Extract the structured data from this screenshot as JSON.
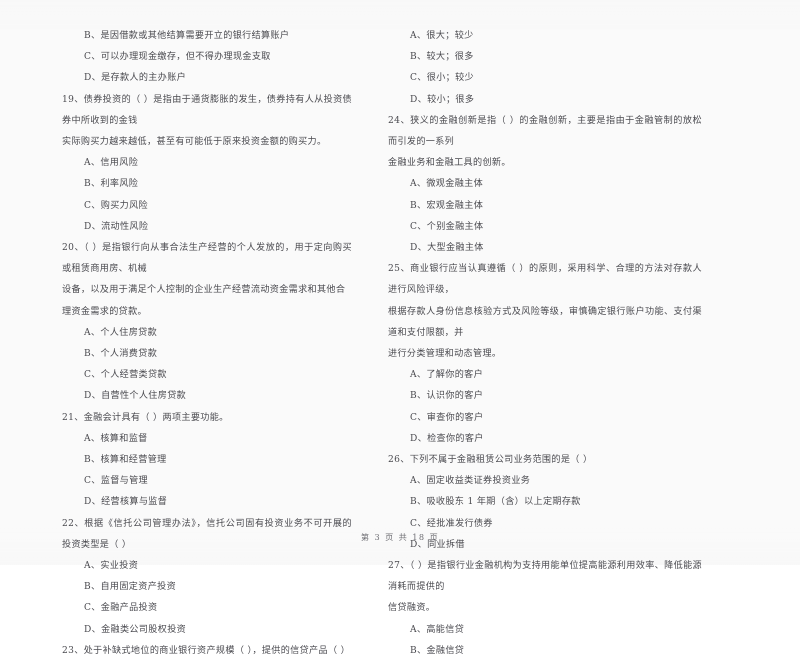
{
  "document": {
    "type": "exam-paper",
    "language": "zh-CN",
    "footer": "第 3 页 共 18 页"
  },
  "left_column": {
    "carryover_options": [
      "B、是因借款或其他结算需要开立的银行结算账户",
      "C、可以办理现金缴存，但不得办理现金支取",
      "D、是存款人的主办账户"
    ],
    "questions": [
      {
        "number": "19",
        "stem_line1": "19、债券投资的（      ）是指由于通货膨胀的发生，债券持有人从投资债券中所收到的金钱",
        "stem_line2": "实际购买力越来越低，甚至有可能低于原来投资金额的购买力。",
        "options": [
          "A、信用风险",
          "B、利率风险",
          "C、购买力风险",
          "D、流动性风险"
        ]
      },
      {
        "number": "20",
        "stem_line1": "20、（      ）是指银行向从事合法生产经营的个人发放的，用于定向购买或租赁商用房、机械",
        "stem_line2": "设备，以及用于满足个人控制的企业生产经营流动资金需求和其他合理资金需求的贷款。",
        "options": [
          "A、个人住房贷款",
          "B、个人消费贷款",
          "C、个人经营类贷款",
          "D、自营性个人住房贷款"
        ]
      },
      {
        "number": "21",
        "stem_line1": "21、金融会计具有（      ）两项主要功能。",
        "stem_line2": "",
        "options": [
          "A、核算和监督",
          "B、核算和经营管理",
          "C、监督与管理",
          "D、经营核算与监督"
        ]
      },
      {
        "number": "22",
        "stem_line1": "22、根据《信托公司管理办法》，信托公司固有投资业务不可开展的投资类型是（      ）",
        "stem_line2": "",
        "options": [
          "A、实业投资",
          "B、自用固定资产投资",
          "C、金融产品投资",
          "D、金融类公司股权投资"
        ]
      },
      {
        "number": "23",
        "stem_line1": "23、处于补缺式地位的商业银行资产规模（      ），提供的信贷产品（      ）",
        "stem_line2": "",
        "options": []
      }
    ]
  },
  "right_column": {
    "carryover_options": [
      "A、很大；较少",
      "B、较大；很多",
      "C、很小；较少",
      "D、较小；很多"
    ],
    "questions": [
      {
        "number": "24",
        "stem_line1": "24、狭义的金融创新是指（      ）的金融创新，主要是指由于金融管制的放松而引发的一系列",
        "stem_line2": "金融业务和金融工具的创新。",
        "stem_line3": "",
        "options": [
          "A、微观金融主体",
          "B、宏观金融主体",
          "C、个别金融主体",
          "D、大型金融主体"
        ]
      },
      {
        "number": "25",
        "stem_line1": "25、商业银行应当认真遵循（      ）的原则，采用科学、合理的方法对存款人进行风险评级，",
        "stem_line2": "根据存款人身份信息核验方式及风险等级，审慎确定银行账户功能、支付渠道和支付限额，并",
        "stem_line3": "进行分类管理和动态管理。",
        "options": [
          "A、了解你的客户",
          "B、认识你的客户",
          "C、审查你的客户",
          "D、检查你的客户"
        ]
      },
      {
        "number": "26",
        "stem_line1": "26、下列不属于金融租赁公司业务范围的是（      ）",
        "stem_line2": "",
        "stem_line3": "",
        "options": [
          "A、固定收益类证券投资业务",
          "B、吸收股东 1 年期（含）以上定期存款",
          "C、经批准发行债券",
          "D、同业拆借"
        ]
      },
      {
        "number": "27",
        "stem_line1": "27、（      ）是指银行业金融机构为支持用能单位提高能源利用效率、降低能源消耗而提供的",
        "stem_line2": "信贷融资。",
        "stem_line3": "",
        "options": [
          "A、高能信贷",
          "B、金融信贷"
        ]
      }
    ]
  }
}
